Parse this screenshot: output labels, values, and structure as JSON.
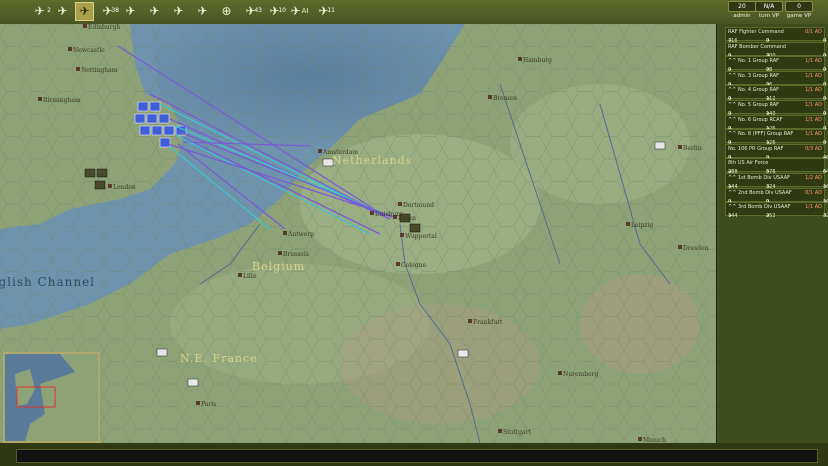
{
  "toolbar": {
    "tools": [
      {
        "icon": "plane-ground-icon",
        "badge": "2"
      },
      {
        "icon": "plane-attack-icon",
        "badge": ""
      },
      {
        "icon": "plane-recon-icon",
        "badge": "",
        "active": true
      },
      {
        "icon": "plane-bomb-icon",
        "badge": "38"
      },
      {
        "icon": "plane-fighter-icon",
        "badge": ""
      },
      {
        "icon": "plane-escort-icon",
        "badge": ""
      },
      {
        "icon": "plane-intercept-icon",
        "badge": ""
      },
      {
        "icon": "plane-sweep-icon",
        "badge": ""
      },
      {
        "icon": "plane-transport-icon",
        "badge": ""
      },
      {
        "icon": "plane-patrol-icon",
        "badge": "43"
      },
      {
        "icon": "plane-naval-icon",
        "badge": "10"
      },
      {
        "icon": "plane-ai-icon",
        "badge": "",
        "text": "AI"
      },
      {
        "icon": "plane-upgrade-icon",
        "badge": "11"
      }
    ],
    "stats": [
      {
        "value": "20",
        "label": "admin"
      },
      {
        "value": "N/A",
        "label": "turn VP"
      },
      {
        "value": "0",
        "label": "game VP"
      }
    ]
  },
  "map": {
    "cities": [
      "Edinburgh",
      "Newcastle",
      "Nottingham",
      "Birmingham",
      "London",
      "Amsterdam",
      "Hamburg",
      "Bremen",
      "Berlin",
      "Antwerp",
      "Brussels",
      "Duisburg",
      "Dortmund",
      "Essen",
      "Wuppertal",
      "Cologne",
      "Lille",
      "Frankfurt",
      "Leipzig",
      "Dresden",
      "Paris",
      "Nuremberg",
      "Stuttgart",
      "Munich"
    ],
    "regions": [
      {
        "label": "Netherlands"
      },
      {
        "label": "Belgium"
      },
      {
        "label": "N.E. France"
      }
    ],
    "sea": "English Channel"
  },
  "panel": {
    "units": [
      {
        "name": "RAF Fighter Command",
        "ad": "0/1 AD",
        "a": "716",
        "b": "0",
        "c": "0"
      },
      {
        "name": "RAF Bomber Command",
        "ad": "",
        "a": "0",
        "b": "700",
        "c": "0"
      },
      {
        "name": "^^ No. 1 Group RAF",
        "ad": "1/1 AD",
        "a": "0",
        "b": "98",
        "c": "0"
      },
      {
        "name": "^^ No. 3 Group RAF",
        "ad": "1/1 AD",
        "a": "0",
        "b": "96",
        "c": "0"
      },
      {
        "name": "^^ No. 4 Group RAF",
        "ad": "1/1 AD",
        "a": "0",
        "b": "112",
        "c": "0"
      },
      {
        "name": "^^ No. 5 Group RAF",
        "ad": "1/1 AD",
        "a": "0",
        "b": "140",
        "c": "0"
      },
      {
        "name": "^^ No. 6 Group RCAF",
        "ad": "1/1 AD",
        "a": "0",
        "b": "126",
        "c": "0"
      },
      {
        "name": "^^ No. 8 (PFF) Group RAF",
        "ad": "1/1 AD",
        "a": "0",
        "b": "126",
        "c": "0"
      },
      {
        "name": "No. 106 PR Group RAF",
        "ad": "0/3 AD",
        "a": "0",
        "b": "0",
        "c": "48"
      },
      {
        "name": "8th US Air Force",
        "ad": "",
        "a": "288",
        "b": "576",
        "c": "64"
      },
      {
        "name": "^^ 1st Bomb Div USAAF",
        "ad": "1/2 AD",
        "a": "144",
        "b": "324",
        "c": "16"
      },
      {
        "name": "^^ 2nd Bomb Div USAAF",
        "ad": "0/1 AD",
        "a": "0",
        "b": "0",
        "c": "16"
      },
      {
        "name": "^^ 3rd Bomb Div USAAF",
        "ad": "1/1 AD",
        "a": "144",
        "b": "252",
        "c": "32"
      }
    ]
  },
  "colors": {
    "land": "#8ea278",
    "sea": "#6f93ad",
    "panel": "#3f4c1c",
    "route": "#7b5ad6"
  }
}
